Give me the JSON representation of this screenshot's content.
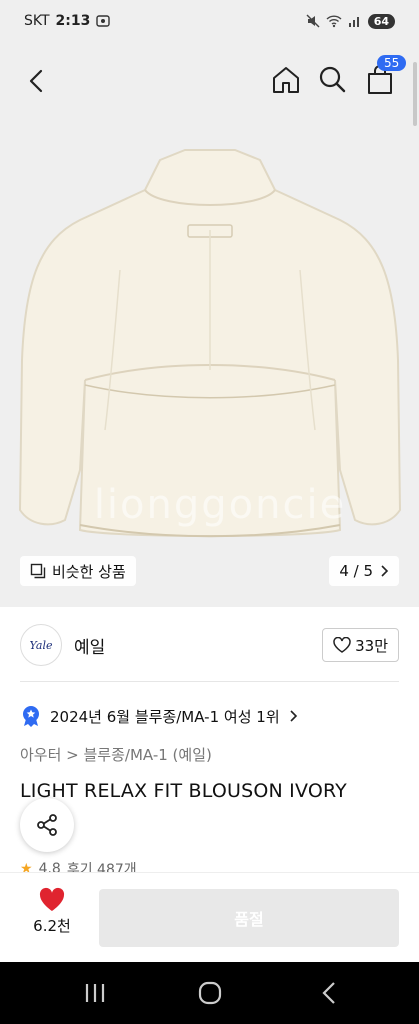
{
  "status": {
    "carrier": "SKT",
    "time": "2:13",
    "battery": "64"
  },
  "header": {
    "cart_count": "55"
  },
  "gallery": {
    "watermark": "lionggoncie",
    "similar_label": "비슷한 상품",
    "page_indicator": "4 / 5"
  },
  "brand": {
    "logo_text": "Yale",
    "name": "예일",
    "like_count": "33만"
  },
  "ranking": {
    "text": "2024년 6월 블루종/MA-1 여성 1위"
  },
  "category": {
    "path": "아우터 > 블루종/MA-1 (예일)"
  },
  "product": {
    "title": "LIGHT RELAX FIT BLOUSON IVORY"
  },
  "rating": {
    "score": "4.8",
    "reviews": "후기 487개"
  },
  "bottom": {
    "wish_count": "6.2천",
    "buy_label": "품절"
  },
  "colors": {
    "accent": "#2f6bf2",
    "heart": "#e0242f",
    "soldout": "#e8e8e8"
  }
}
